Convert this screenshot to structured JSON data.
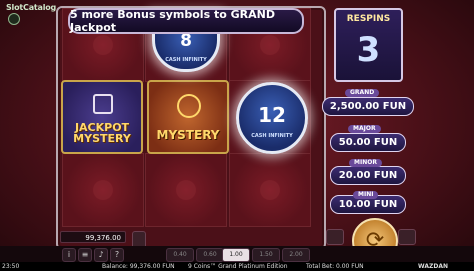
{
  "watermark": "SlotCatalog",
  "banner": "5 more Bonus symbols to GRAND Jackpot",
  "respins": {
    "title": "RESPINS",
    "value": "3"
  },
  "symbols": {
    "jackpot_mystery": "JACKPOT MYSTERY",
    "mystery": "MYSTERY",
    "coin_top": "8",
    "coin_main": "12",
    "coin_sub": "CASH INFINITY"
  },
  "prizes": [
    {
      "label": "GRAND",
      "value": "2,500.00 FUN"
    },
    {
      "label": "MAJOR",
      "value": "50.00 FUN"
    },
    {
      "label": "MINOR",
      "value": "20.00 FUN"
    },
    {
      "label": "MINI",
      "value": "10.00 FUN"
    }
  ],
  "controls": {
    "balance_box": "99,376.00",
    "bets": [
      "0.40",
      "0.60",
      "1.00",
      "1.50",
      "2.00"
    ],
    "selected_bet": "1.00",
    "spin_icon": "refresh-icon",
    "menu_icon": "menu-icon",
    "info_icon": "info-icon",
    "help_icon": "help-icon",
    "power_icon": "power-icon"
  },
  "status": {
    "time": "23:50",
    "balance": "Balance: 99,376.00 FUN",
    "game": "9 Coins™ Grand Platinum Edition",
    "total_bet": "Total Bet: 0.00 FUN",
    "provider": "WAZDAN"
  },
  "colors": {
    "accent_gold": "#c9a54a",
    "panel_purple": "#2e1f5a",
    "board_red": "#5a121b"
  }
}
